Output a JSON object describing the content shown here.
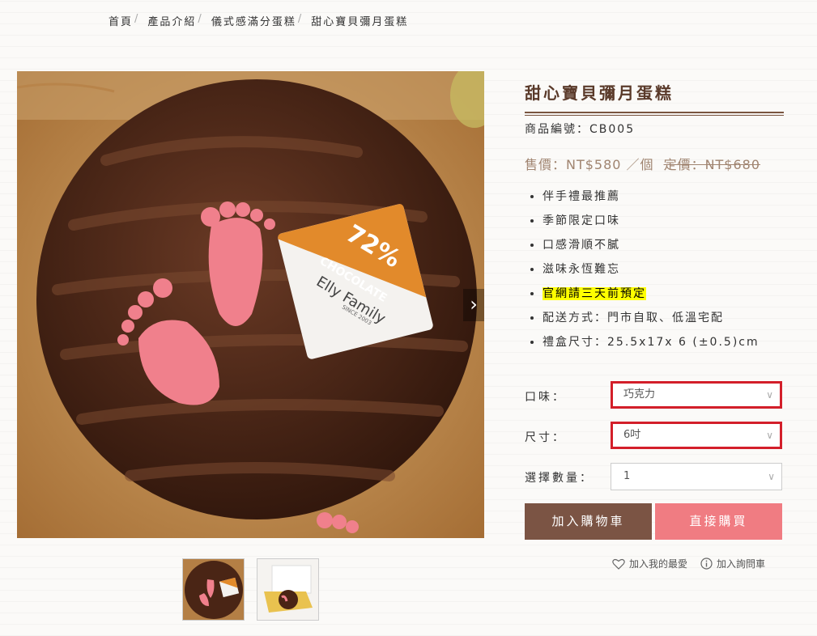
{
  "breadcrumb": {
    "items": [
      "首頁",
      "產品介紹",
      "儀式感滿分蛋糕",
      "甜心寶貝彌月蛋糕"
    ],
    "separator": "/"
  },
  "gallery": {
    "next_icon": "chevron-right-icon",
    "main_image": "chocolate-cake-with-baby-feet-and-72-chocolate-elly-family-plaque",
    "plaque": {
      "percent": "72%",
      "word": "CHOCOLATE",
      "brand": "Elly Family",
      "since": "SINCE 2003"
    },
    "thumbnails": [
      "cake-top-view",
      "cake-in-gift-box"
    ]
  },
  "product": {
    "title": "甜心寶貝彌月蛋糕",
    "code": "商品編號：CB005",
    "price": "售價：NT$580 ／個",
    "original_price": "定價：NT$680",
    "features": [
      {
        "text": "伴手禮最推薦",
        "highlight": false
      },
      {
        "text": "季節限定口味",
        "highlight": false
      },
      {
        "text": "口感滑順不膩",
        "highlight": false
      },
      {
        "text": "滋味永恆難忘",
        "highlight": false
      },
      {
        "text": "官網請三天前預定",
        "highlight": true
      },
      {
        "text": "配送方式：門市自取、低溫宅配",
        "highlight": false
      },
      {
        "text": "禮盒尺寸：25.5x17x 6 (±0.5)cm",
        "highlight": false
      }
    ]
  },
  "options": {
    "flavor": {
      "label": "口味：",
      "value": "巧克力"
    },
    "size": {
      "label": "尺寸：",
      "value": "6吋"
    },
    "quantity": {
      "label": "選擇數量：",
      "value": "1"
    }
  },
  "actions": {
    "add_to_cart": "加入購物車",
    "buy_now": "直接購買",
    "favorite": "加入我的最愛",
    "inquiry": "加入詢問車"
  },
  "colors": {
    "title": "#5a3a2a",
    "cart_button": "#7b5444",
    "buy_button": "#f07c82",
    "highlight": "#ffff00",
    "select_highlight_border": "#d31f2a"
  }
}
